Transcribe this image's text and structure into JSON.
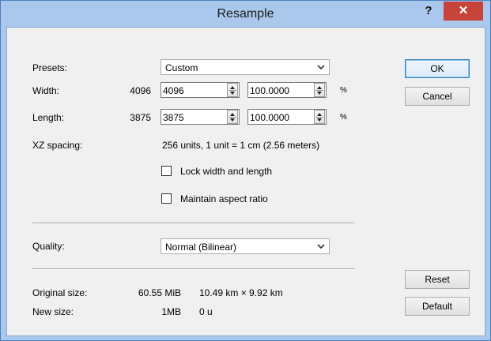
{
  "window": {
    "title": "Resample",
    "help_glyph": "?",
    "close_glyph": "✕"
  },
  "presets": {
    "label": "Presets:",
    "value": "Custom"
  },
  "width": {
    "label": "Width:",
    "original": "4096",
    "value": "4096",
    "percent": "100.0000",
    "unit": "%"
  },
  "length": {
    "label": "Length:",
    "original": "3875",
    "value": "3875",
    "percent": "100.0000",
    "unit": "%"
  },
  "spacing": {
    "label": "XZ spacing:",
    "value": "256 units, 1 unit = 1 cm (2.56 meters)"
  },
  "options": {
    "lock_label": "Lock width and length",
    "lock_checked": false,
    "aspect_label": "Maintain aspect ratio",
    "aspect_checked": false
  },
  "quality": {
    "label": "Quality:",
    "value": "Normal (Bilinear)"
  },
  "info": {
    "original_label": "Original size:",
    "original_size": "60.55 MiB",
    "original_dims": "10.49 km × 9.92 km",
    "new_label": "New size:",
    "new_size": "1MB",
    "new_dims": "0 u"
  },
  "buttons": {
    "ok": "OK",
    "cancel": "Cancel",
    "reset": "Reset",
    "default": "Default"
  },
  "colors": {
    "titlebar": "#a9c8ec",
    "close_button": "#c7443a",
    "client": "#f0f0f0"
  }
}
